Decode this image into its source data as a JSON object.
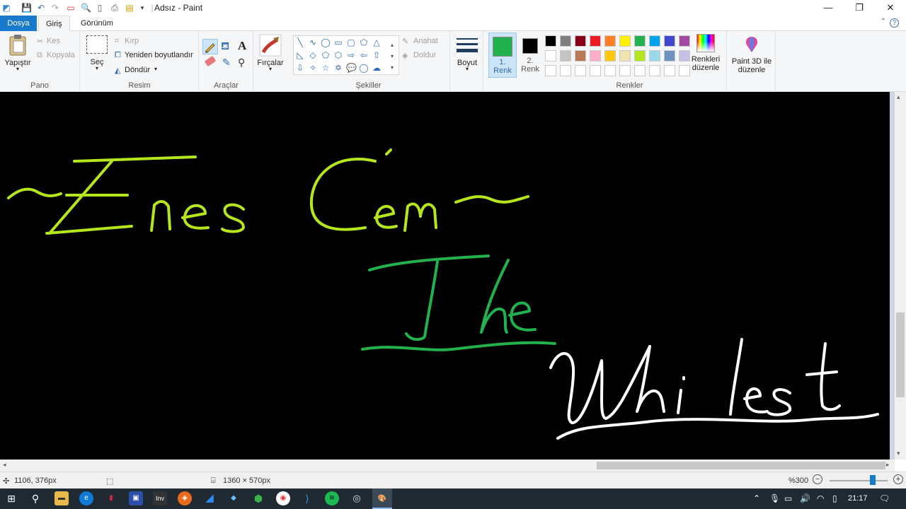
{
  "window": {
    "title": "Adsız - Paint"
  },
  "tabs": {
    "file": "Dosya",
    "home": "Giriş",
    "view": "Görünüm"
  },
  "ribbon": {
    "clipboard": {
      "paste": "Yapıştır",
      "cut": "Kes",
      "copy": "Kopyala",
      "group": "Pano"
    },
    "image": {
      "select": "Seç",
      "crop": "Kırp",
      "resize": "Yeniden boyutlandır",
      "rotate": "Döndür",
      "group": "Resim"
    },
    "tools": {
      "group": "Araçlar"
    },
    "brushes": {
      "label": "Fırçalar"
    },
    "shapes": {
      "outline": "Anahat",
      "fill": "Doldur",
      "group": "Şekiller"
    },
    "size": {
      "label": "Boyut"
    },
    "colors": {
      "color1_num": "1.",
      "color1_word": "Renk",
      "color2_num": "2.",
      "color2_word": "Renk",
      "edit_line1": "Renkleri",
      "edit_line2": "düzenle",
      "paint3d_line1": "Paint 3D ile",
      "paint3d_line2": "düzenle",
      "group": "Renkler",
      "color1_value": "#22b14c",
      "color2_value": "#000000",
      "palette_row1": [
        "#000000",
        "#7f7f7f",
        "#880015",
        "#ed1c24",
        "#ff7f27",
        "#fff200",
        "#22b14c",
        "#00a2e8",
        "#3f48cc",
        "#a349a4"
      ],
      "palette_row2": [
        "#ffffff",
        "#c3c3c3",
        "#b97a57",
        "#ffaec9",
        "#ffc90e",
        "#efe4b0",
        "#b5e61d",
        "#99d9ea",
        "#7092be",
        "#c8bfe7"
      ]
    }
  },
  "canvas": {
    "background": "#000000",
    "text_colors": {
      "name": "#b5e61d",
      "the": "#22b14c",
      "whitest": "#ffffff"
    }
  },
  "status": {
    "cursor_pos": "1106, 376px",
    "canvas_size": "1360 × 570px",
    "zoom": "%300"
  },
  "taskbar": {
    "clock": "21:17"
  }
}
